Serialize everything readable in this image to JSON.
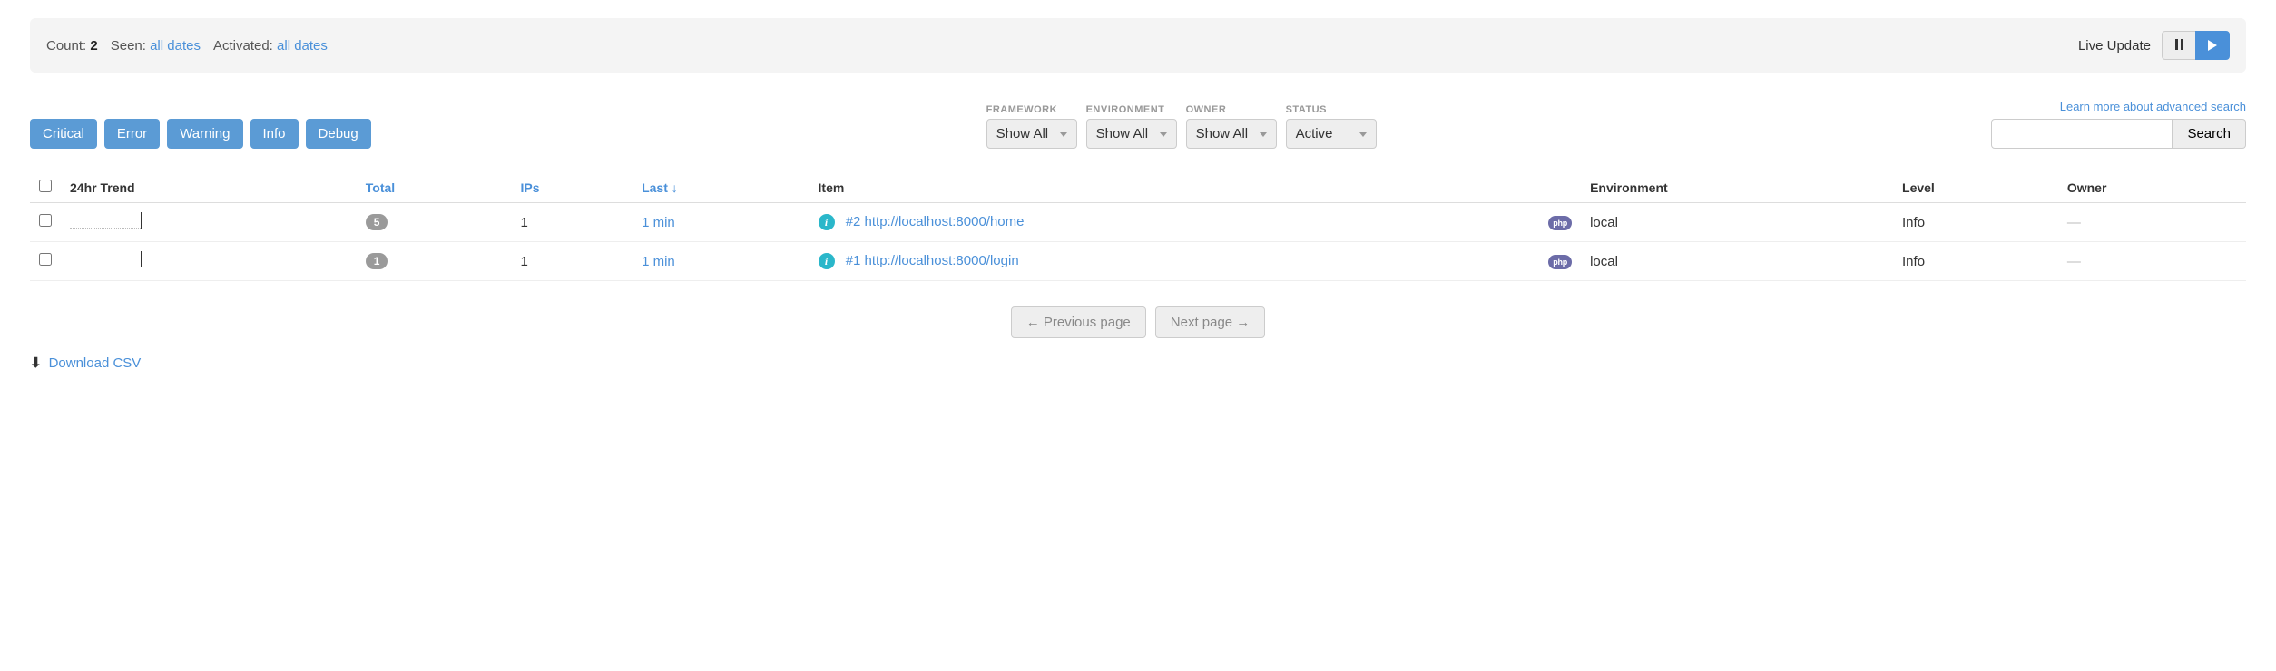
{
  "summary": {
    "count_label": "Count:",
    "count_value": "2",
    "seen_label": "Seen:",
    "seen_value": "all dates",
    "activated_label": "Activated:",
    "activated_value": "all dates",
    "live_update_label": "Live Update"
  },
  "level_buttons": {
    "critical": "Critical",
    "error": "Error",
    "warning": "Warning",
    "info": "Info",
    "debug": "Debug"
  },
  "filters": {
    "framework": {
      "label": "FRAMEWORK",
      "value": "Show All"
    },
    "environment": {
      "label": "ENVIRONMENT",
      "value": "Show All"
    },
    "owner": {
      "label": "OWNER",
      "value": "Show All"
    },
    "status": {
      "label": "STATUS",
      "value": "Active"
    }
  },
  "search": {
    "link": "Learn more about advanced search",
    "button": "Search",
    "value": ""
  },
  "columns": {
    "trend": "24hr Trend",
    "total": "Total",
    "ips": "IPs",
    "last": "Last ↓",
    "item": "Item",
    "environment": "Environment",
    "level": "Level",
    "owner": "Owner"
  },
  "rows": [
    {
      "total": "5",
      "ips": "1",
      "last": "1 min",
      "item": "#2 http://localhost:8000/home",
      "php": "php",
      "environment": "local",
      "level": "Info",
      "owner": "—"
    },
    {
      "total": "1",
      "ips": "1",
      "last": "1 min",
      "item": "#1 http://localhost:8000/login",
      "php": "php",
      "environment": "local",
      "level": "Info",
      "owner": "—"
    }
  ],
  "pager": {
    "prev": "← Previous page",
    "next": "Next page →"
  },
  "download": "Download CSV"
}
